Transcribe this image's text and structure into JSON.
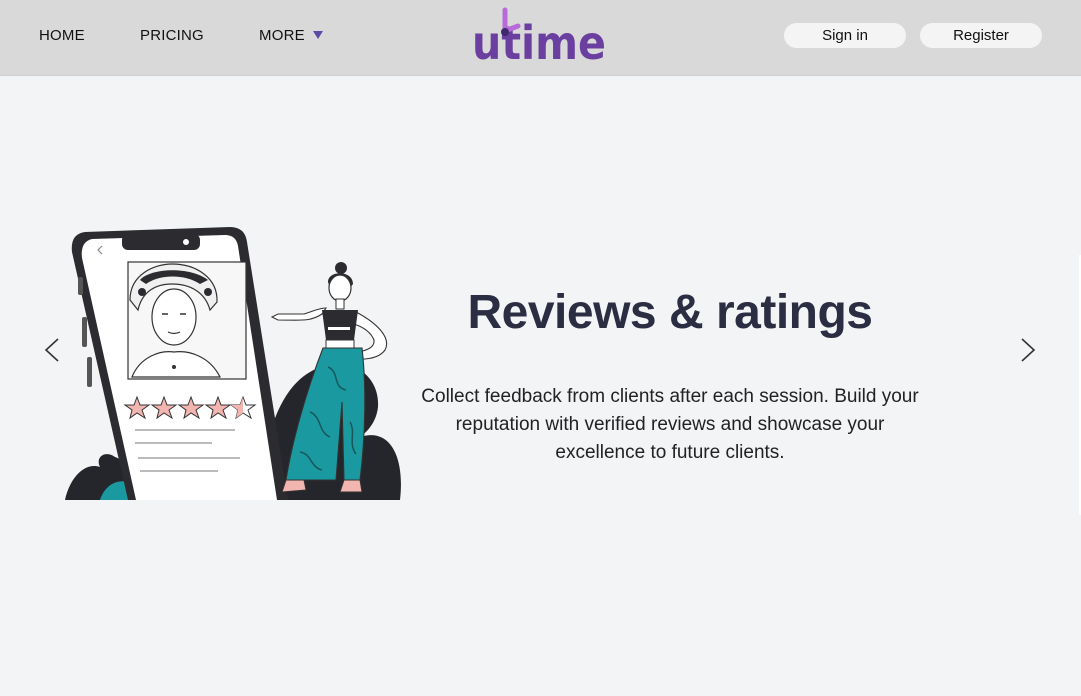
{
  "nav": {
    "home": "HOME",
    "pricing": "PRICING",
    "more": "MORE",
    "logo_text": "utime",
    "sign_in": "Sign in",
    "register": "Register"
  },
  "slide": {
    "title": "Reviews & ratings",
    "description": "Collect feedback from clients after each session. Build your reputation with verified reviews and showcase your excellence to future clients.",
    "rating_stars": 4.5,
    "rating_max": 5
  },
  "icons": {
    "prev": "chevron-left-icon",
    "next": "chevron-right-icon",
    "more_caret": "caret-down-icon"
  },
  "colors": {
    "nav_bg": "#d9d9d9",
    "page_bg": "#f3f4f6",
    "accent": "#5b4aa8",
    "logo_purple": "#6b3fa0",
    "title": "#2b2d42",
    "teal": "#1a9aa0",
    "star": "#f3b5b0"
  }
}
